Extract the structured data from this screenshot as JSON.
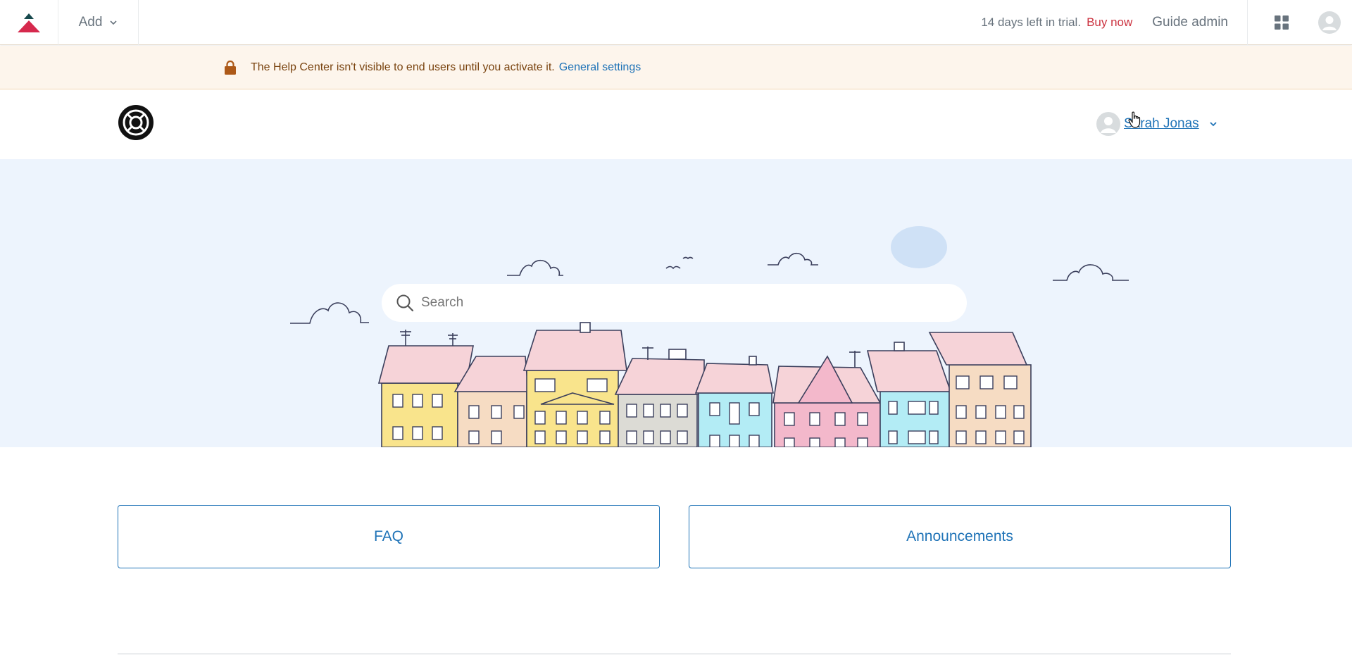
{
  "topbar": {
    "add_label": "Add",
    "trial_text": "14 days left in trial.",
    "buy_now_label": "Buy now",
    "guide_admin_label": "Guide admin"
  },
  "notice": {
    "message": "The Help Center isn't visible to end users until you activate it.",
    "link_label": "General settings"
  },
  "header": {
    "user_name": "Sarah Jonas"
  },
  "search": {
    "placeholder": "Search"
  },
  "categories": [
    {
      "label": "FAQ"
    },
    {
      "label": "Announcements"
    }
  ],
  "colors": {
    "brand_link": "#1f73b7",
    "buy_now": "#cc3340",
    "notice_bg": "#fdf5ec",
    "hero_bg": "#edf4fd",
    "logo_red": "#d6294d",
    "logo_dark": "#17494d"
  },
  "icons": {
    "product_logo": "zendesk-triangle-icon",
    "add_chevron": "chevron-down-icon",
    "apps": "grid-icon",
    "profile": "avatar-icon",
    "notice": "lock-icon",
    "hc_logo": "lifebuoy-icon",
    "search": "search-icon"
  }
}
